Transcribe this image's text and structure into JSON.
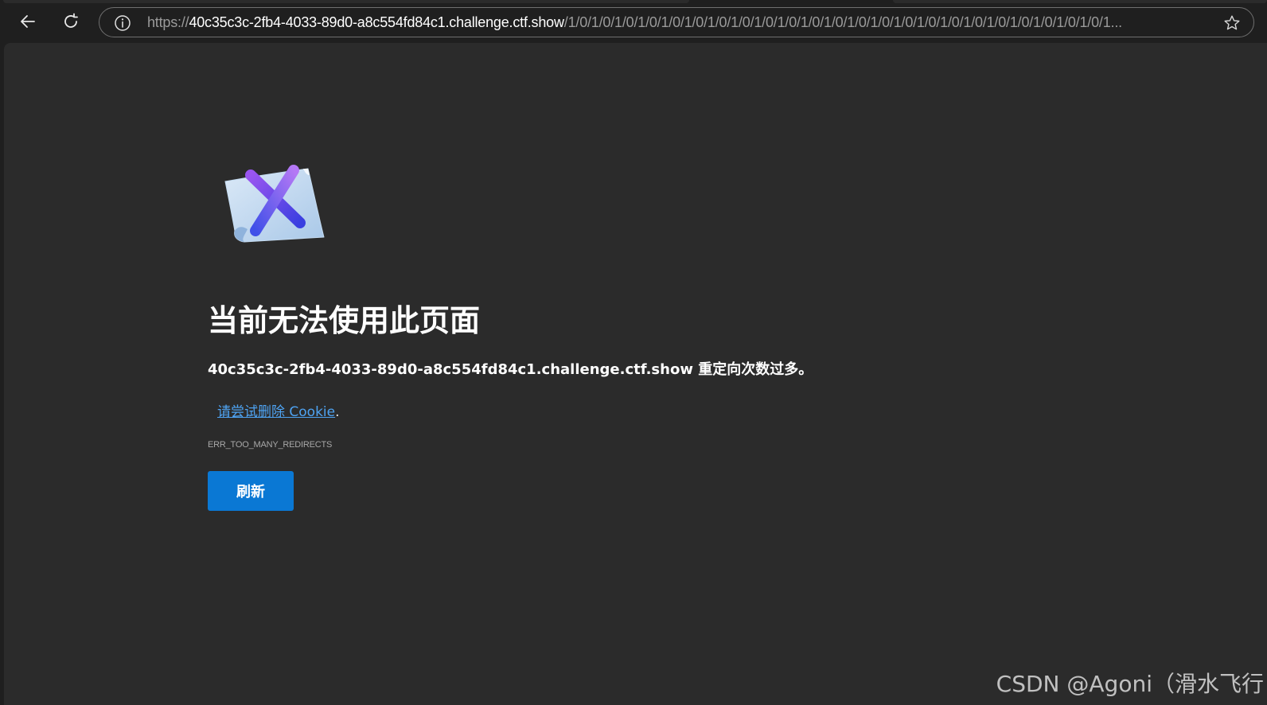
{
  "browser": {
    "url_scheme": "https://",
    "url_host": "40c35c3c-2fb4-4033-89d0-a8c554fd84c1.challenge.ctf.show",
    "url_path": "/1/0/1/0/1/0/1/0/1/0/1/0/1/0/1/0/1/0/1/0/1/0/1/0/1/0/1/0/1/0/1/0/1/0/1/0/1/0/1/0/1/0/1/0/1/0/1...",
    "icons": {
      "back": "back-arrow-icon",
      "reload": "reload-icon",
      "site_info": "info-icon",
      "favorite": "star-icon"
    }
  },
  "error_page": {
    "icon": "error-document-x-icon",
    "title": "当前无法使用此页面",
    "detail": "40c35c3c-2fb4-4033-89d0-a8c554fd84c1.challenge.ctf.show 重定向次数过多。",
    "suggestion_link": "请尝试删除 Cookie",
    "suggestion_suffix": ".",
    "error_code": "ERR_TOO_MANY_REDIRECTS",
    "refresh_label": "刷新"
  },
  "watermark": "CSDN @Agoni（滑水飞行",
  "colors": {
    "toolbar_bg": "#1f1f1f",
    "content_bg": "#2b2b2b",
    "link": "#4ea3f2",
    "button": "#0a78d4"
  }
}
